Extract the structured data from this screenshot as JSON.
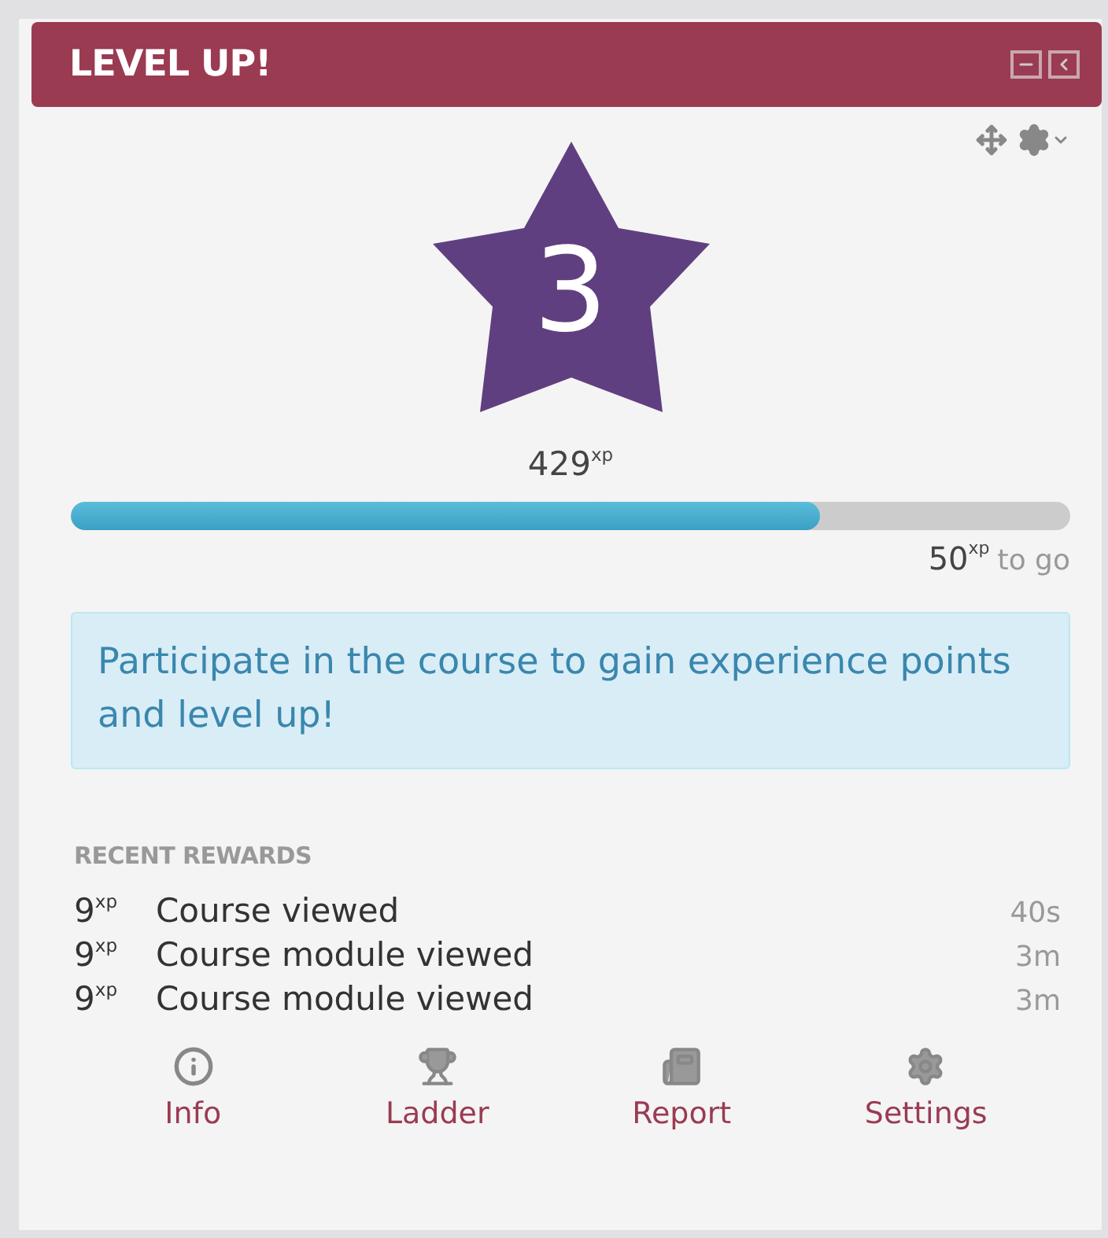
{
  "block": {
    "title": "LEVEL UP!"
  },
  "level": {
    "number": "3",
    "points": "429$^{xp}$",
    "progress": {
      "level": 0.75
    },
    "to_go": {
      "amount": "50$^{xp}$",
      "label": "to go"
    }
  },
  "notice": "Participate in the course to gain experience points and level up!",
  "recent_rewards": {
    "heading": "RECENT REWARDS",
    "items": [
      {
        "points": "9$^{xp}$",
        "description": "Course viewed",
        "time": "40s"
      },
      {
        "points": "9$^{xp}$",
        "description": "Course module viewed",
        "time": "3m"
      },
      {
        "points": "9$^{xp}$",
        "description": "Course module viewed",
        "time": "3m"
      }
    ]
  },
  "footer_links": [
    {
      "kind": "info",
      "label": "Info"
    },
    {
      "kind": "ladder",
      "label": "Ladder"
    },
    {
      "kind": "report",
      "label": "Report"
    },
    {
      "kind": "settings",
      "label": "Settings"
    }
  ]
}
